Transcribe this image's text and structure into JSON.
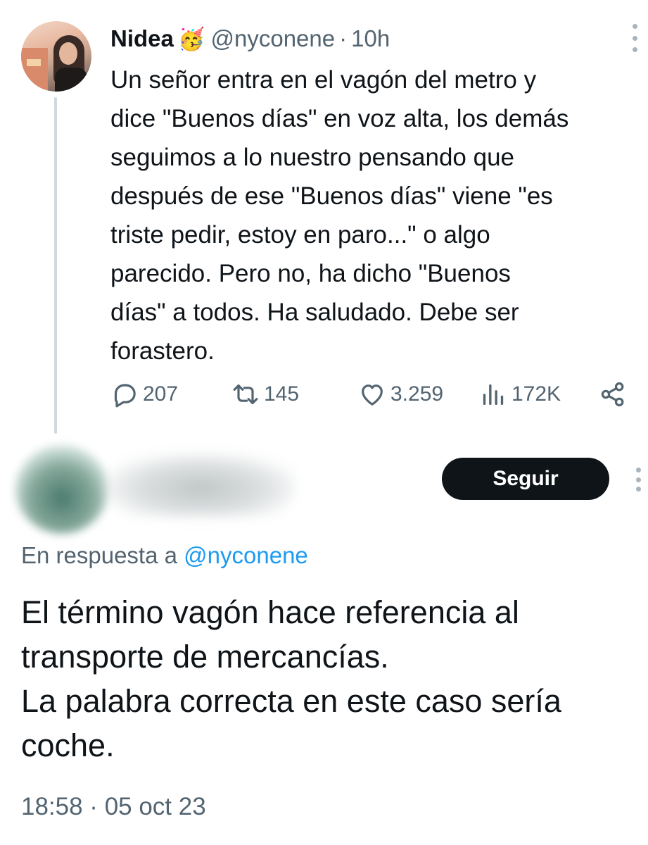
{
  "parent_tweet": {
    "display_name": "Nidea",
    "emoji": "🥳",
    "handle": "@nyconene",
    "separator": "·",
    "time": "10h",
    "text_lines": [
      "Un señor entra en el vagón del metro y",
      "dice \"Buenos días\" en voz alta, los demás",
      "seguimos a lo nuestro pensando que",
      "después de ese \"Buenos días\" viene \"es",
      "triste pedir, estoy en paro...\" o algo",
      "parecido. Pero no, ha dicho \"Buenos",
      "días\" a todos. Ha saludado. Debe ser",
      "forastero."
    ],
    "actions": {
      "replies": "207",
      "retweets": "145",
      "likes": "3.259",
      "views": "172K"
    }
  },
  "reply_tweet": {
    "follow_label": "Seguir",
    "reply_to_prefix": "En respuesta a",
    "reply_to_handle": "@nyconene",
    "text_lines": [
      "El término vagón hace referencia al",
      "transporte de mercancías.",
      "La palabra correcta en este caso sería",
      "coche."
    ],
    "timestamp": "18:58 · 05 oct 23"
  },
  "colors": {
    "text_primary": "#0f1419",
    "text_secondary": "#536471",
    "link": "#1d9bf0",
    "thread_line": "#cfd9de",
    "button_bg": "#0f1419"
  },
  "icons": [
    "reply-icon",
    "retweet-icon",
    "like-icon",
    "views-icon",
    "share-icon",
    "more-icon"
  ]
}
